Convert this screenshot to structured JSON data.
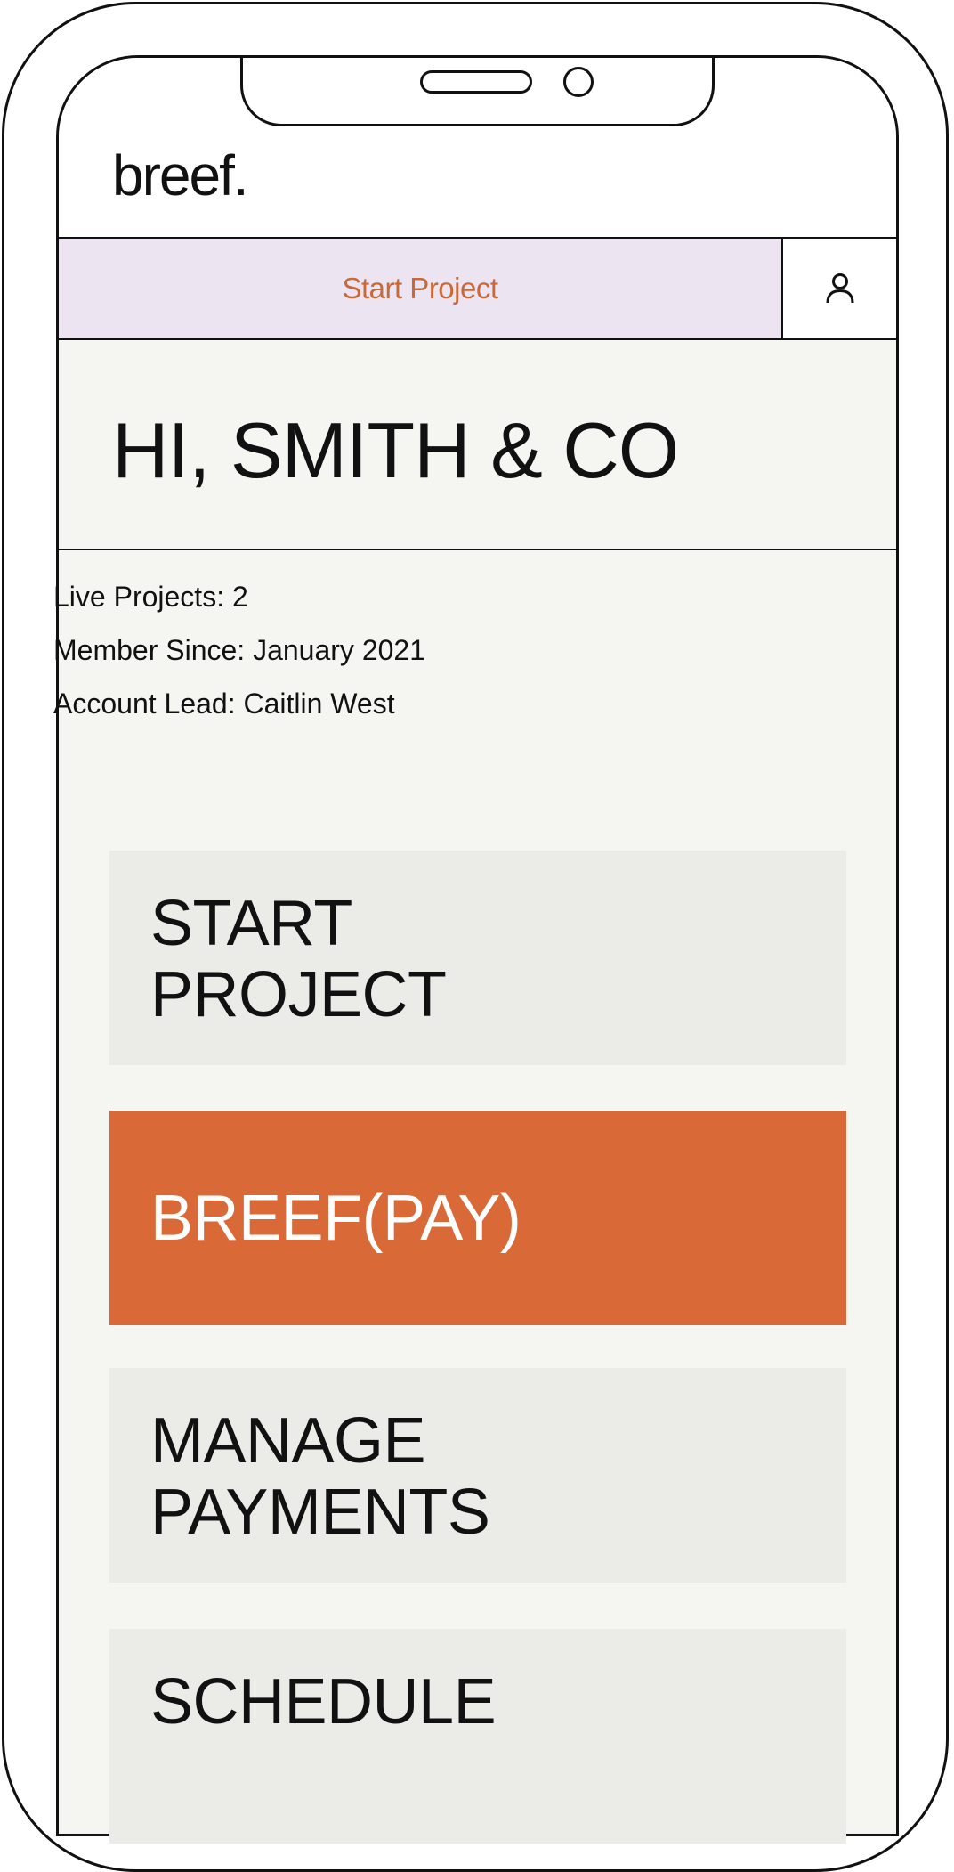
{
  "header": {
    "logo": "breef."
  },
  "nav": {
    "start_project_label": "Start Project",
    "profile_icon": "user-icon"
  },
  "greeting": "HI, SMITH & CO",
  "account_info": {
    "live_projects": "Live Projects: 2",
    "member_since": "Member Since: January 2021",
    "account_lead": "Account Lead: Caitlin West"
  },
  "cards": [
    {
      "line1": "START",
      "line2": "PROJECT"
    },
    {
      "line1": "BREEF(PAY)"
    },
    {
      "line1": "MANAGE",
      "line2": "PAYMENTS"
    },
    {
      "line1": "SCHEDULE"
    }
  ],
  "colors": {
    "accent": "#d96a38",
    "nav_highlight": "#ede4f1",
    "background": "#f5f5f1",
    "card_background": "#ebebe7"
  }
}
